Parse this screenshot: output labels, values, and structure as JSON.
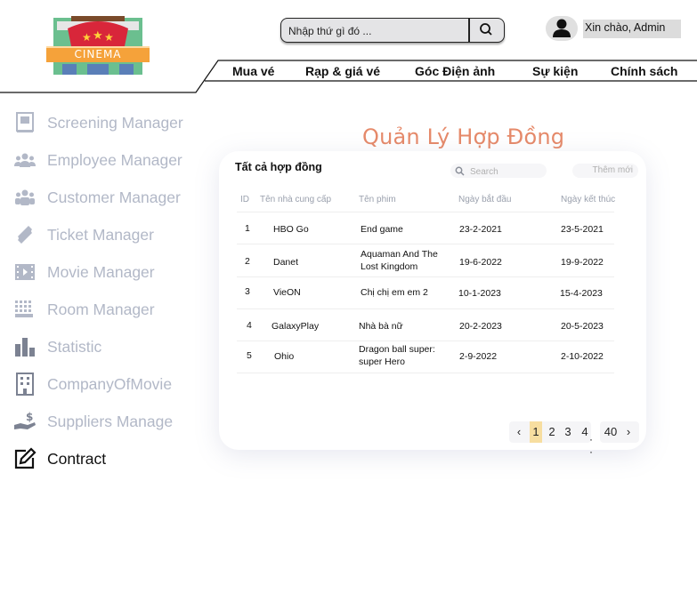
{
  "header": {
    "logo_text": "CINEMA",
    "search": {
      "placeholder": "Nhập thứ gì đó ..."
    },
    "greeting": "Xin chào, Admin"
  },
  "nav": {
    "items": [
      "Mua vé",
      "Rạp & giá vé",
      "Góc Điện ảnh",
      "Sự kiện",
      "Chính sách"
    ]
  },
  "sidebar": {
    "items": [
      {
        "label": "Screening Manager",
        "icon": "screening-icon"
      },
      {
        "label": "Employee Manager",
        "icon": "employee-group-icon"
      },
      {
        "label": "Customer Manager",
        "icon": "customer-group-icon"
      },
      {
        "label": "Ticket Manager",
        "icon": "ticket-icon"
      },
      {
        "label": "Movie Manager",
        "icon": "film-icon"
      },
      {
        "label": "Room Manager",
        "icon": "room-grid-icon"
      },
      {
        "label": "Statistic",
        "icon": "bar-chart-icon"
      },
      {
        "label": "CompanyOfMovie",
        "icon": "building-icon"
      },
      {
        "label": "Suppliers Manage",
        "icon": "hand-money-icon"
      },
      {
        "label": "Contract",
        "icon": "edit-icon"
      }
    ],
    "active_index": 9
  },
  "main": {
    "title": "Quản Lý Hợp Đồng",
    "card_title": "Tất cả hợp đồng",
    "search_placeholder": "Search",
    "add_label": "Thêm mới",
    "columns": [
      "ID",
      "Tên nhà cung cấp",
      "Tên phim",
      "Ngày bắt đầu",
      "Ngày kết thúc"
    ],
    "rows": [
      {
        "id": "1",
        "supplier": "HBO Go",
        "movie": "End game",
        "start": "23-2-2021",
        "end": "23-5-2021"
      },
      {
        "id": "2",
        "supplier": "Danet",
        "movie": "Aquaman And The Lost Kingdom",
        "start": "19-6-2022",
        "end": "19-9-2022"
      },
      {
        "id": "3",
        "supplier": "VieON",
        "movie": "Chị chị em em 2",
        "start": "10-1-2023",
        "end": "15-4-2023"
      },
      {
        "id": "4",
        "supplier": "GalaxyPlay",
        "movie": "Nhà bà nữ",
        "start": "20-2-2023",
        "end": "20-5-2023"
      },
      {
        "id": "5",
        "supplier": "Ohio",
        "movie": "Dragon ball super: super Hero",
        "start": "2-9-2022",
        "end": "2-10-2022"
      }
    ],
    "pagination": {
      "prev": "‹",
      "pages": [
        "1",
        "2",
        "3",
        "4"
      ],
      "ellipsis": "·",
      "last": "40",
      "next": "›",
      "current": "1"
    }
  },
  "colors": {
    "title": "#e68a6a",
    "sidebar_inactive": "#b2b8c7",
    "active_page": "#f7dea0"
  }
}
